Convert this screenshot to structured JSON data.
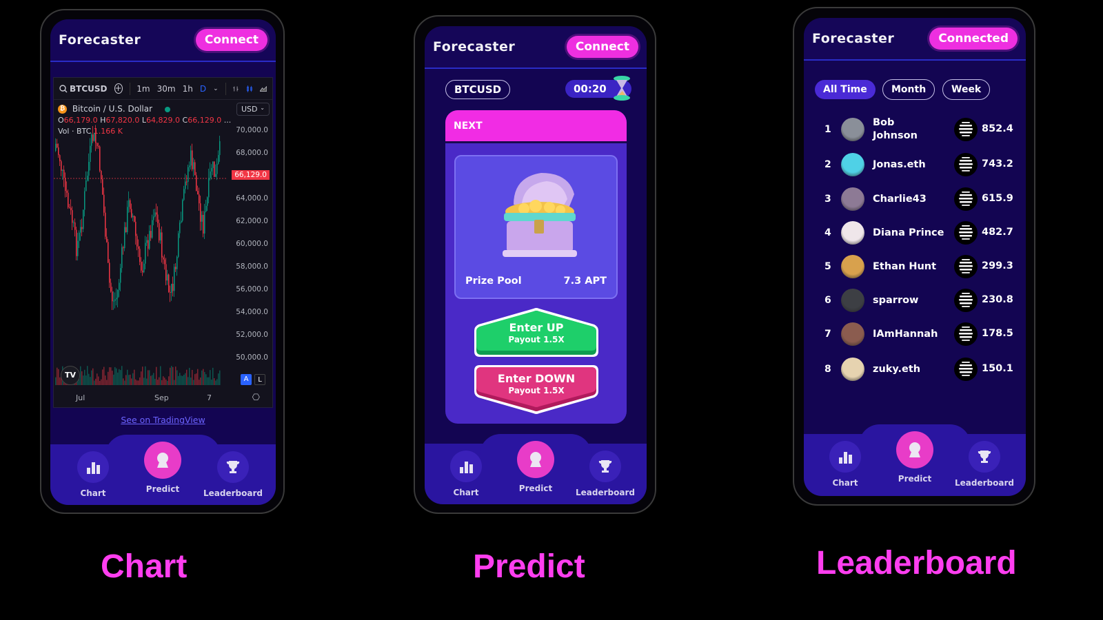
{
  "app": {
    "title": "Forecaster"
  },
  "captions": {
    "chart": "Chart",
    "predict": "Predict",
    "leaderboard": "Leaderboard"
  },
  "chart_screen": {
    "connect_label": "Connect",
    "toolbar": {
      "symbol": "BTCUSD",
      "intervals": [
        "1m",
        "30m",
        "1h",
        "D"
      ],
      "active_interval": "D"
    },
    "legend": {
      "pair": "Bitcoin / U.S. Dollar",
      "open_label": "O",
      "open": "66,179.0",
      "high_label": "H",
      "high": "67,820.0",
      "low_label": "L",
      "low": "64,829.0",
      "close_label": "C",
      "close": "66,129.0",
      "ellipsis": "...",
      "vol_label": "Vol · BTC",
      "vol": "1.166 K"
    },
    "currency": "USD",
    "price_ticks": [
      "70,000.0",
      "68,000.0",
      "64,000.0",
      "62,000.0",
      "60,000.0",
      "58,000.0",
      "56,000.0",
      "54,000.0",
      "52,000.0",
      "50,000.0"
    ],
    "last_price": "66,129.0",
    "time_ticks": [
      "Jul",
      "Sep",
      "7"
    ],
    "scale_buttons": [
      "A",
      "L"
    ],
    "tv_logo": "TV",
    "see_on_tv": "See on TradingView",
    "colors": {
      "up": "#089981",
      "down": "#f23645"
    }
  },
  "predict_screen": {
    "connect_label": "Connect",
    "symbol": "BTCUSD",
    "timer": "00:20",
    "round_label": "NEXT",
    "prize_pool_label": "Prize Pool",
    "prize_pool_value": "7.3 APT",
    "enter_up": {
      "title": "Enter UP",
      "payout": "Payout 1.5X"
    },
    "enter_down": {
      "title": "Enter DOWN",
      "payout": "Payout 1.5X"
    }
  },
  "leaderboard_screen": {
    "connect_label": "Connected",
    "tabs": [
      {
        "label": "All Time",
        "active": true
      },
      {
        "label": "Month",
        "active": false
      },
      {
        "label": "Week",
        "active": false
      }
    ],
    "rows": [
      {
        "rank": "1",
        "name": "Bob Johnson",
        "score": "852.4",
        "avatar_color": "#8a8f99"
      },
      {
        "rank": "2",
        "name": "Jonas.eth",
        "score": "743.2",
        "avatar_color": "#4fd1e6"
      },
      {
        "rank": "3",
        "name": "Charlie43",
        "score": "615.9",
        "avatar_color": "#8d7a95"
      },
      {
        "rank": "4",
        "name": "Diana Prince",
        "score": "482.7",
        "avatar_color": "#efe6ea"
      },
      {
        "rank": "5",
        "name": "Ethan Hunt",
        "score": "299.3",
        "avatar_color": "#d8a14d"
      },
      {
        "rank": "6",
        "name": "sparrow",
        "score": "230.8",
        "avatar_color": "#3d3f44"
      },
      {
        "rank": "7",
        "name": "IAmHannah",
        "score": "178.5",
        "avatar_color": "#8b5c4f"
      },
      {
        "rank": "8",
        "name": "zuky.eth",
        "score": "150.1",
        "avatar_color": "#e6d3b0"
      }
    ]
  },
  "nav": {
    "items": [
      {
        "label": "Chart",
        "icon": "bar-chart-icon"
      },
      {
        "label": "Predict",
        "icon": "crystal-ball-icon"
      },
      {
        "label": "Leaderboard",
        "icon": "trophy-icon"
      }
    ],
    "active": "Predict"
  },
  "colors": {
    "accent_pink": "#ee2fe0",
    "screen_bg": "#130552",
    "nav_bg": "#2a15a0",
    "up_green": "#1ecf6a",
    "down_pink": "#e0357f",
    "caption": "#ff3ef0"
  }
}
